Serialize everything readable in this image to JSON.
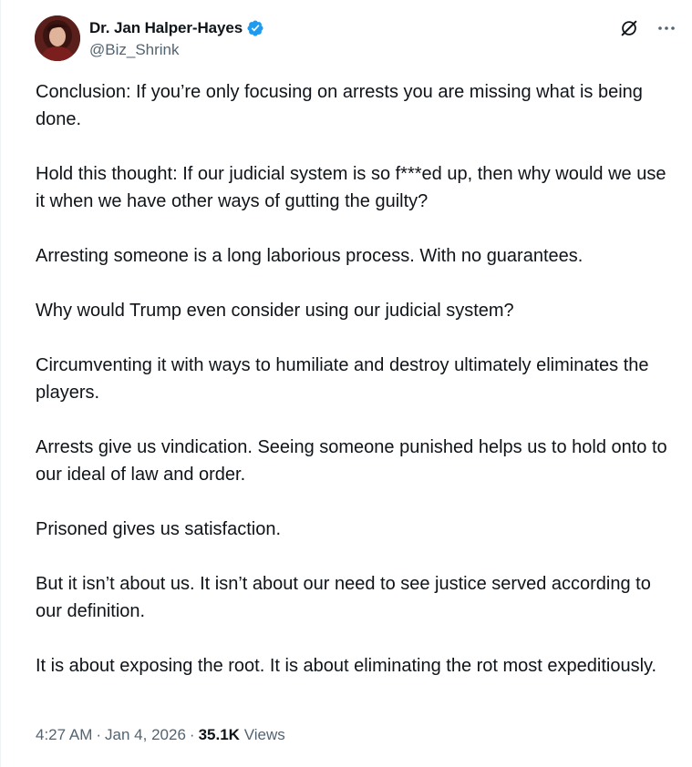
{
  "author": {
    "display_name": "Dr. Jan Halper-Hayes",
    "handle": "@Biz_Shrink",
    "verified": true,
    "verified_color": "#1d9bf0"
  },
  "actions": {
    "grok_icon": "grok-slash-icon",
    "more_icon": "more-horizontal-icon"
  },
  "tweet": {
    "paragraphs": [
      "Conclusion: If you’re only focusing on arrests you are missing what is being done.",
      "Hold this thought: If our judicial system is so f***ed up, then why would we use it when we have other ways of gutting the guilty?",
      "Arresting someone is a long laborious process. With no guarantees.",
      "Why would Trump even consider using our judicial system?",
      "Circumventing it with ways to humiliate and destroy ultimately eliminates the players.",
      "Arrests give us vindication. Seeing someone punished helps us to hold onto to our ideal of law and order.",
      "Prisoned gives us satisfaction.",
      "But it isn’t about us. It isn’t about our need to see justice served according to our definition.",
      "It is about exposing the root. It is about eliminating the rot most expeditiously."
    ]
  },
  "meta": {
    "time": "4:27 AM",
    "separator": "·",
    "date": "Jan 4, 2026",
    "views_count": "35.1K",
    "views_label": "Views"
  },
  "colors": {
    "text_primary": "#0f1419",
    "text_secondary": "#536471",
    "border": "#eff3f4"
  }
}
